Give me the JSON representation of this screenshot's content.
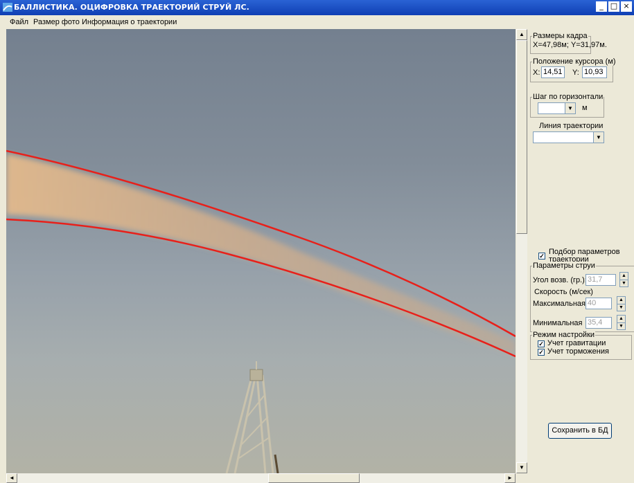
{
  "window": {
    "title": "БАЛЛИСТИКА. ОЦИФРОВКА ТРАЕКТОРИЙ СТРУЙ ЛС.",
    "minimize_glyph": "_",
    "maximize_glyph": "□",
    "close_glyph": "×"
  },
  "menu": {
    "items": [
      "Файл",
      "Размер фото",
      "Информация о траектории"
    ]
  },
  "frame_size": {
    "legend": "Размеры кадра",
    "value": "X=47,98м;  Y=31,97м."
  },
  "cursor_position": {
    "legend": "Положение курсора (м)",
    "x_label": "X:",
    "x_value": "14,51",
    "y_label": "Y:",
    "y_value": "10,93"
  },
  "horizontal_step": {
    "legend": "Шаг по горизонтали",
    "value": "",
    "unit": "м"
  },
  "trajectory_line": {
    "label": "Линия траектории",
    "value": ""
  },
  "fit_params": {
    "checked": true,
    "label_line1": "Подбор параметров",
    "label_line2": "траектории"
  },
  "jet_params": {
    "legend": "Параметры струи",
    "angle_label": "Угол возв. (гр.):",
    "angle_value": "31,7",
    "speed_legend": "Скорость (м/сек)",
    "max_label": "Максимальная",
    "max_value": "40",
    "min_label": "Минимальная",
    "min_value": "35,4"
  },
  "mode": {
    "legend": "Режим настройки",
    "gravity_label": "Учет гравитации",
    "gravity_checked": true,
    "drag_label": "Учет торможения",
    "drag_checked": true
  },
  "save_button": {
    "label": "Сохранить в БД"
  },
  "trajectory_overlay": {
    "color": "#e8201a",
    "jet_color": "#d9b48a"
  },
  "icons": [
    "app-icon",
    "scroll-up-arrow-icon",
    "scroll-down-arrow-icon",
    "scroll-left-arrow-icon",
    "scroll-right-arrow-icon",
    "dropdown-arrow-icon",
    "spin-up-icon",
    "spin-down-icon",
    "check-icon"
  ]
}
